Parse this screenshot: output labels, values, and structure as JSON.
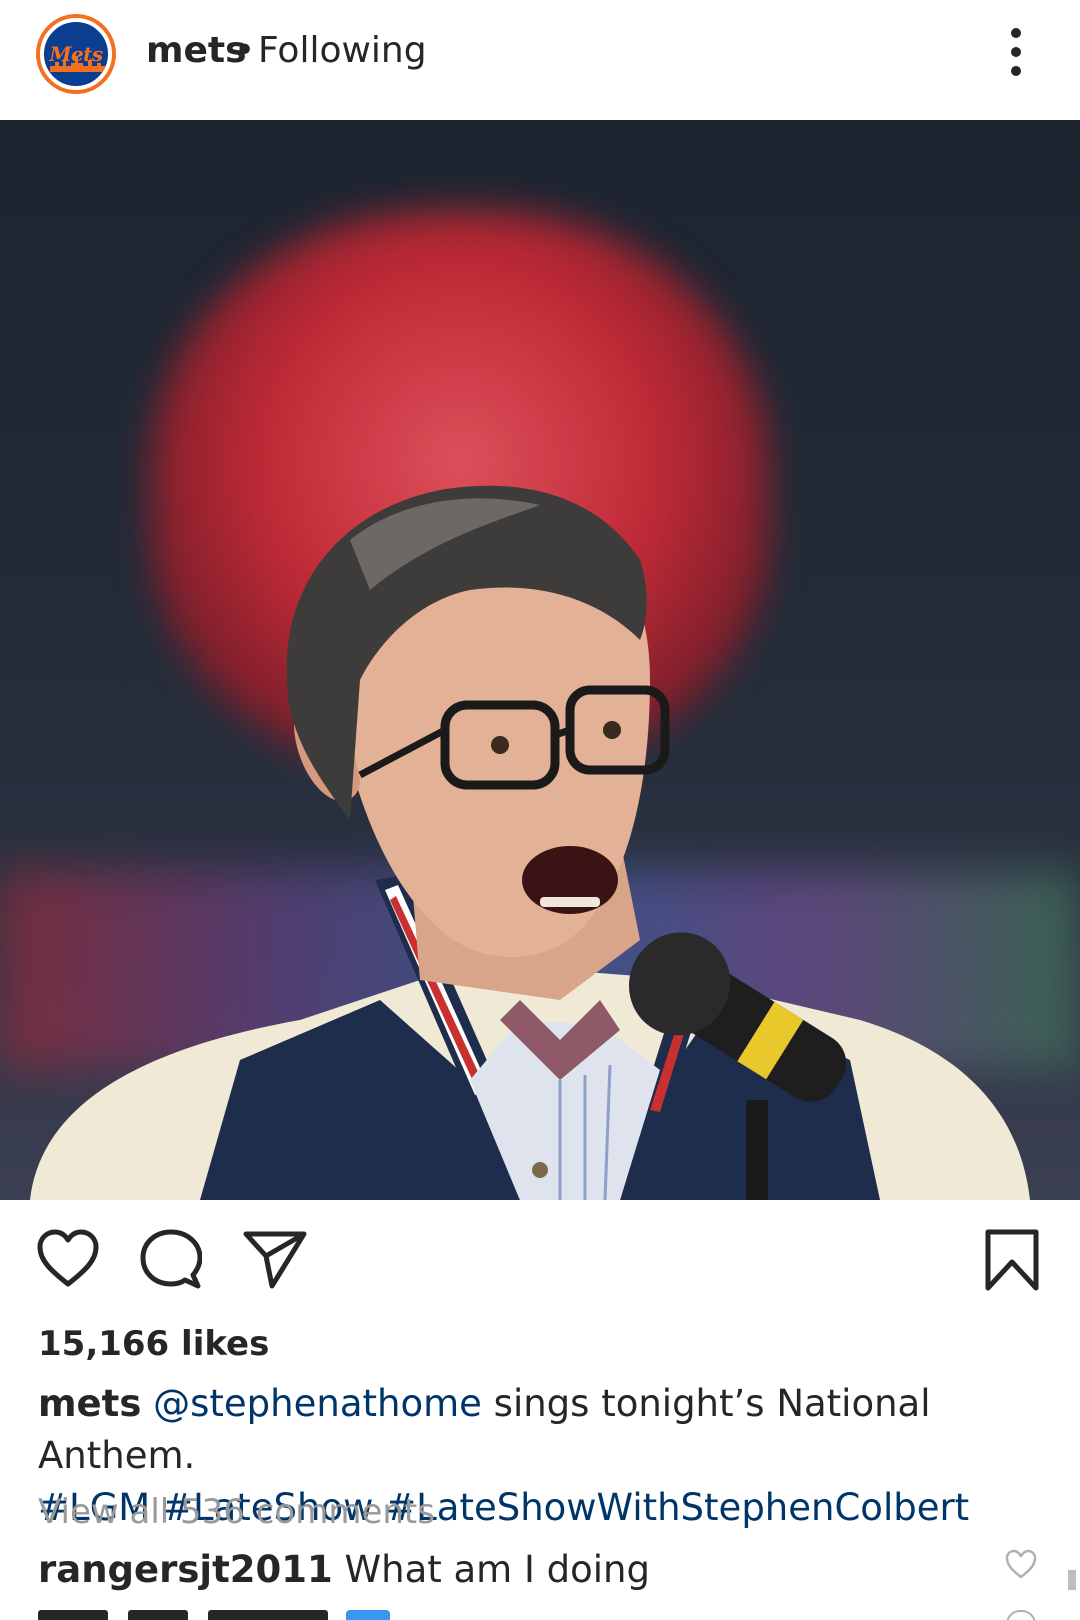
{
  "header": {
    "avatar_logo_text": "Mets",
    "username": "mets",
    "separator": "•",
    "follow_status": "Following"
  },
  "icons": {
    "more": "more-vertical-icon",
    "like": "heart-outline-icon",
    "comment": "comment-bubble-icon",
    "share": "send-paper-plane-icon",
    "save": "bookmark-outline-icon",
    "comment_like": "small-heart-outline-icon"
  },
  "post": {
    "likes": "15,166 likes",
    "caption_user": "mets",
    "caption_mention": "@stephenathome",
    "caption_text": " sings tonight’s National Anthem.",
    "hashtags": [
      "#LGM",
      "#LateShow",
      "#LateShowWithStephenColbert"
    ],
    "view_comments": "View all 536 comments",
    "comments": [
      {
        "user": "rangersjt2011",
        "text": "What am I doing"
      }
    ]
  },
  "colors": {
    "link": "#003569",
    "muted": "#999999",
    "text": "#262626",
    "mets_orange": "#f37021",
    "mets_blue": "#0b3d91"
  }
}
